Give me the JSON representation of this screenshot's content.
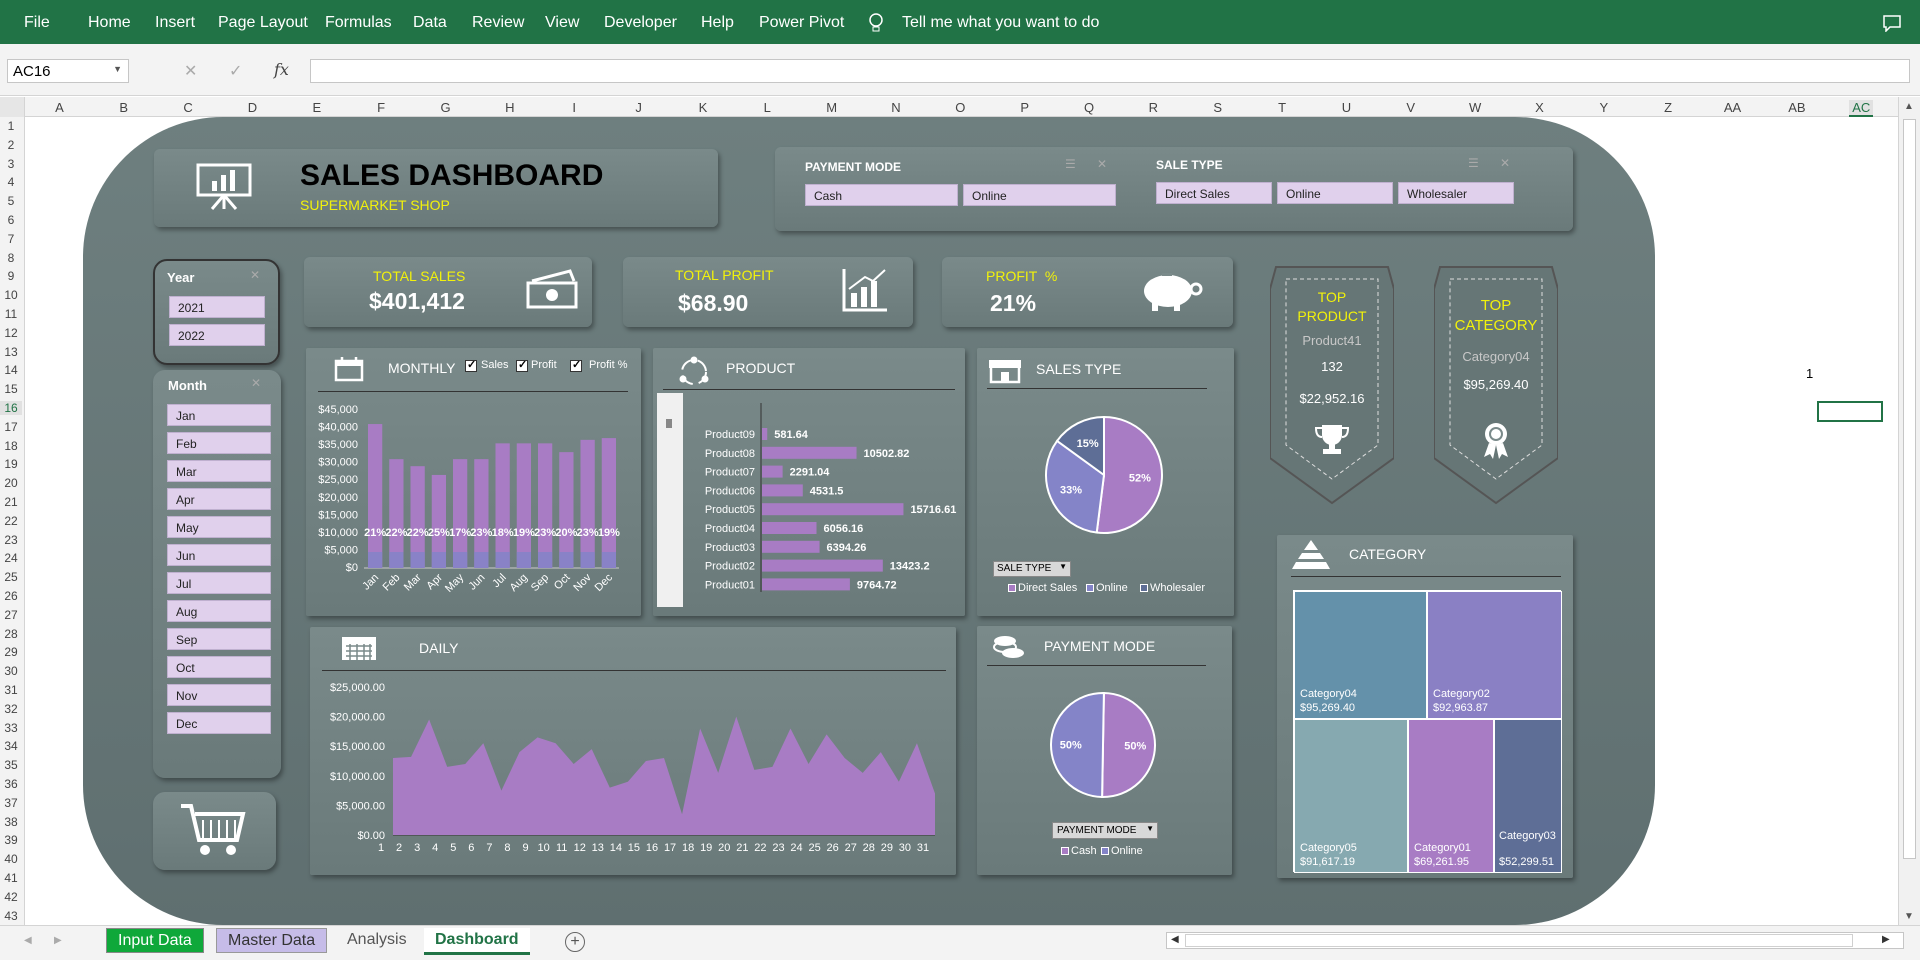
{
  "ribbon": {
    "items": [
      "File",
      "Home",
      "Insert",
      "Page Layout",
      "Formulas",
      "Data",
      "Review",
      "View",
      "Developer",
      "Help",
      "Power Pivot"
    ],
    "tell_me": "Tell me what you want to do"
  },
  "formula_bar": {
    "name_box": "AC16",
    "cancel": "✕",
    "enter": "✓",
    "fx": "fx",
    "value": ""
  },
  "columns": [
    "A",
    "B",
    "C",
    "D",
    "E",
    "F",
    "G",
    "H",
    "I",
    "J",
    "K",
    "L",
    "M",
    "N",
    "O",
    "P",
    "Q",
    "R",
    "S",
    "T",
    "U",
    "V",
    "W",
    "X",
    "Y",
    "Z",
    "AA",
    "AB",
    "AC"
  ],
  "rows": [
    "1",
    "2",
    "3",
    "4",
    "5",
    "6",
    "7",
    "8",
    "9",
    "10",
    "11",
    "12",
    "13",
    "14",
    "15",
    "16",
    "17",
    "18",
    "19",
    "20",
    "21",
    "22",
    "23",
    "24",
    "25",
    "26",
    "27",
    "28",
    "29",
    "30",
    "31",
    "32",
    "33",
    "34",
    "35",
    "36",
    "37",
    "38",
    "39",
    "40",
    "41",
    "42",
    "43"
  ],
  "cell_value": "1",
  "header": {
    "title": "SALES DASHBOARD",
    "subtitle": "SUPERMARKET SHOP"
  },
  "slicers": {
    "payment_mode": {
      "title": "PAYMENT MODE",
      "items": [
        "Cash",
        "Online"
      ]
    },
    "sale_type": {
      "title": "SALE TYPE",
      "items": [
        "Direct Sales",
        "Online",
        "Wholesaler"
      ]
    },
    "year": {
      "title": "Year",
      "items": [
        "2021",
        "2022"
      ]
    },
    "month": {
      "title": "Month",
      "items": [
        "Jan",
        "Feb",
        "Mar",
        "Apr",
        "May",
        "Jun",
        "Jul",
        "Aug",
        "Sep",
        "Oct",
        "Nov",
        "Dec"
      ]
    }
  },
  "kpis": {
    "total_sales": {
      "label": "TOTAL SALES",
      "value": "$401,412"
    },
    "total_profit": {
      "label": "TOTAL PROFIT",
      "value": "$68.90"
    },
    "profit_pct": {
      "label": "PROFIT  %",
      "value": "21%"
    }
  },
  "top_product": {
    "title": "TOP PRODUCT",
    "name": "Product41",
    "qty": "132",
    "amount": "$22,952.16"
  },
  "top_category": {
    "title": "TOP CATEGORY",
    "name": "Category04",
    "amount": "$95,269.40"
  },
  "monthly": {
    "title": "MONTHLY",
    "checks": [
      "Sales",
      "Profit",
      "Profit %"
    ]
  },
  "product": {
    "title": "PRODUCT"
  },
  "sales_type": {
    "title": "SALES TYPE",
    "filter": "SALE TYPE",
    "legend": [
      "Direct Sales",
      "Online",
      "Wholesaler"
    ]
  },
  "payment": {
    "title": "PAYMENT MODE",
    "filter": "PAYMENT MODE",
    "legend": [
      "Cash",
      "Online"
    ]
  },
  "category": {
    "title": "CATEGORY"
  },
  "daily": {
    "title": "DAILY"
  },
  "sheet_tabs": [
    "Input Data",
    "Master Data",
    "Analysis",
    "Dashboard"
  ],
  "colors": {
    "ribbon": "#217346",
    "purple": "#a87cc4",
    "blue": "#8484c8",
    "dashboard": "#6e7f7f",
    "yellow": "#f2f20a"
  },
  "chart_data": [
    {
      "type": "bar",
      "title": "MONTHLY",
      "categories": [
        "Jan",
        "Feb",
        "Mar",
        "Apr",
        "May",
        "Jun",
        "Jul",
        "Aug",
        "Sep",
        "Oct",
        "Nov",
        "Dec"
      ],
      "series": [
        {
          "name": "Sales",
          "values": [
            41000,
            31000,
            29000,
            26500,
            31000,
            31000,
            35500,
            35500,
            35500,
            33000,
            36500,
            37000
          ]
        },
        {
          "name": "Profit %",
          "values": [
            "21%",
            "22%",
            "22%",
            "25%",
            "17%",
            "23%",
            "18%",
            "19%",
            "23%",
            "20%",
            "23%",
            "19%"
          ]
        }
      ],
      "ylim": [
        0,
        45000
      ],
      "yticks": [
        "$0",
        "$5,000",
        "$10,000",
        "$15,000",
        "$20,000",
        "$25,000",
        "$30,000",
        "$35,000",
        "$40,000",
        "$45,000"
      ]
    },
    {
      "type": "bar",
      "title": "PRODUCT",
      "orientation": "horizontal",
      "categories": [
        "Product09",
        "Product08",
        "Product07",
        "Product06",
        "Product05",
        "Product04",
        "Product03",
        "Product02",
        "Product01"
      ],
      "values": [
        581.64,
        10502.82,
        2291.04,
        4531.5,
        15716.61,
        6056.16,
        6394.26,
        13423.2,
        9764.72
      ],
      "labels": [
        "581.64",
        "10502.82",
        "2291.04",
        "4531.5",
        "15716.61",
        "6056.16",
        "6394.26",
        "13423.2",
        "9764.72"
      ]
    },
    {
      "type": "pie",
      "title": "SALES TYPE",
      "categories": [
        "Direct Sales",
        "Online",
        "Wholesaler"
      ],
      "values": [
        52,
        33,
        15
      ],
      "labels": [
        "52%",
        "33%",
        "15%"
      ]
    },
    {
      "type": "pie",
      "title": "PAYMENT MODE",
      "categories": [
        "Cash",
        "Online"
      ],
      "values": [
        50,
        50
      ],
      "labels": [
        "50%",
        "50%"
      ]
    },
    {
      "type": "treemap",
      "title": "CATEGORY",
      "categories": [
        "Category04",
        "Category02",
        "Category05",
        "Category01",
        "Category03"
      ],
      "values": [
        95269.4,
        92963.87,
        91617.19,
        69261.95,
        52299.51
      ],
      "labels": [
        "$95,269.40",
        "$92,963.87",
        "$91,617.19",
        "$69,261.95",
        "$52,299.51"
      ]
    },
    {
      "type": "area",
      "title": "DAILY",
      "x": [
        1,
        2,
        3,
        4,
        5,
        6,
        7,
        8,
        9,
        10,
        11,
        12,
        13,
        14,
        15,
        16,
        17,
        18,
        19,
        20,
        21,
        22,
        23,
        24,
        25,
        26,
        27,
        28,
        29,
        30,
        31
      ],
      "values": [
        13000,
        13200,
        19500,
        11500,
        12000,
        15500,
        7500,
        14000,
        16500,
        15500,
        12000,
        14500,
        8000,
        9000,
        12500,
        13000,
        3500,
        18000,
        10500,
        20000,
        11000,
        11500,
        18000,
        12000,
        17000,
        13000,
        10500,
        14000,
        9000,
        15500,
        7000
      ],
      "ylim": [
        0,
        25000
      ],
      "yticks": [
        "$0.00",
        "$5,000.00",
        "$10,000.00",
        "$15,000.00",
        "$20,000.00",
        "$25,000.00"
      ]
    }
  ]
}
